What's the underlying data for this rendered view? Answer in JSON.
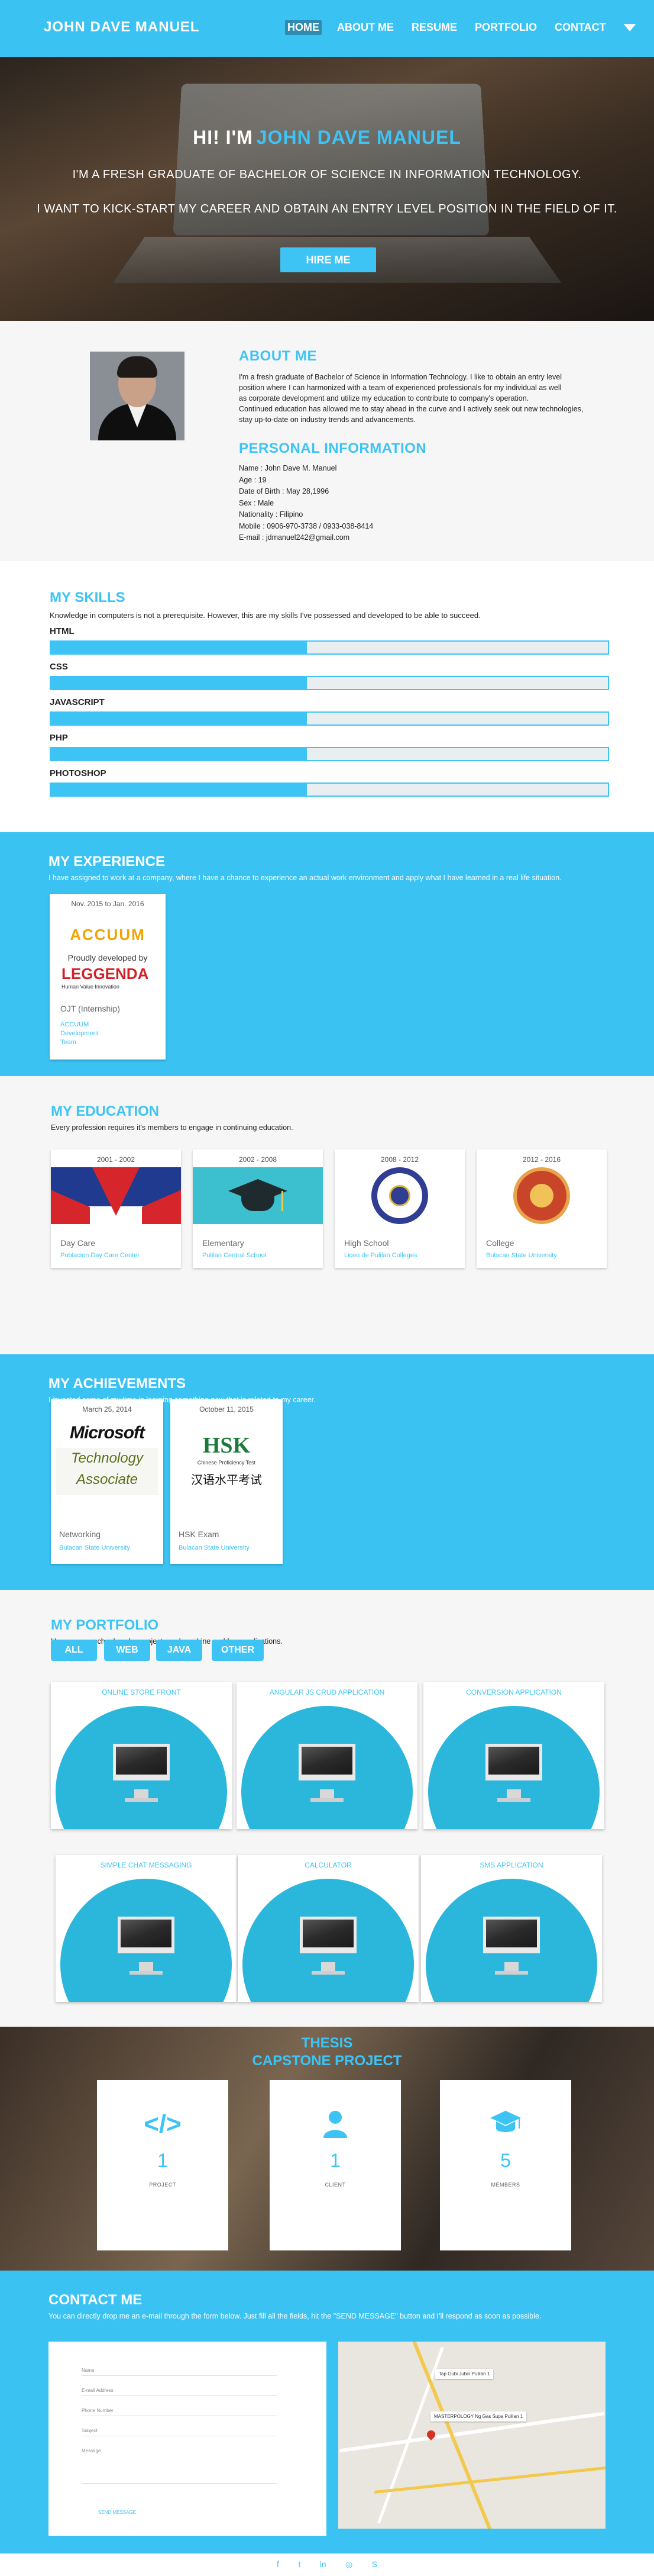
{
  "nav": {
    "brand": "JOHN DAVE MANUEL",
    "links": [
      "HOME",
      "ABOUT ME",
      "RESUME",
      "PORTFOLIO",
      "CONTACT"
    ],
    "active_index": 0
  },
  "hero": {
    "greeting": "HI! I'M",
    "name": "JOHN DAVE MANUEL",
    "line1": "I'M A FRESH GRADUATE OF BACHELOR OF SCIENCE IN INFORMATION TECHNOLOGY.",
    "line2": "I WANT TO KICK-START MY CAREER AND OBTAIN AN ENTRY LEVEL POSITION IN THE FIELD OF IT.",
    "button": "HIRE ME"
  },
  "about": {
    "title": "ABOUT ME",
    "paragraph_lines": [
      "I'm a fresh graduate of Bachelor of Science in Information Technology. I like to obtain an entry level",
      " position where I can harmonized with a team of experienced professionals for my individual as well",
      "as corporate development and utilize my education to contribute to company's operation.",
      "Continued education has allowed me to stay ahead in the curve and I actively seek out new technologies,",
      "stay up-to-date on industry trends and advancements."
    ],
    "info_title": "PERSONAL INFORMATION",
    "info": [
      "Name : John Dave M. Manuel",
      "Age : 19",
      "Date of Birth : May 28,1996",
      "Sex : Male",
      "Nationality : Filipino",
      "Mobile : 0906-970-3738 / 0933-038-8414",
      "E-mail : jdmanuel242@gmail.com"
    ]
  },
  "skills": {
    "title": "MY SKILLS",
    "description": "Knowledge in computers is not a prerequisite. However, this are my skills I've possessed and developed to be able to succeed.",
    "items": [
      {
        "name": "HTML",
        "level": 0.46
      },
      {
        "name": "CSS",
        "level": 0.46
      },
      {
        "name": "JAVASCRIPT",
        "level": 0.46
      },
      {
        "name": "PHP",
        "level": 0.46
      },
      {
        "name": "PHOTOSHOP",
        "level": 0.46
      }
    ]
  },
  "experience": {
    "title": "MY EXPERIENCE",
    "description": "I have assigned to work at a company, where I have a chance to experience an actual work environment and apply what I have learned in a real life situation.",
    "card": {
      "date": "Nov. 2015 to Jan. 2016",
      "logo1": "ACCUUM",
      "logo_caption": "Proudly developed by",
      "logo2": "LEGGENDA",
      "logo2_sub": "Human Value Innovation",
      "title": "OJT (Internship)",
      "sub": [
        "ACCUUM",
        "Development",
        "Team"
      ]
    }
  },
  "education": {
    "title": "MY EDUCATION",
    "description": "Every profession requires it's members to engage in continuing education.",
    "items": [
      {
        "years": "2001 - 2002",
        "level": "Day Care",
        "school": "Poblacion Day Care Center"
      },
      {
        "years": "2002 - 2008",
        "level": "Elementary",
        "school": "Pulilan Central School"
      },
      {
        "years": "2008 - 2012",
        "level": "High School",
        "school": "Liceo de Pulilan Colleges"
      },
      {
        "years": "2012 - 2016",
        "level": "College",
        "school": "Bulacan State University"
      }
    ]
  },
  "achievements": {
    "title": "MY ACHIEVEMENTS",
    "description": "I invested some of my time in learning something new that is related to my career.",
    "items": [
      {
        "date": "March 25, 2014",
        "logo_top": "Microsoft",
        "logo_bottom": "Technology Associate",
        "title": "Networking",
        "sub": "Bulacan State University"
      },
      {
        "date": "October 11, 2015",
        "logo_top": "HSK",
        "logo_mid": "Chinese Proficiency Test",
        "logo_bottom": "汉语水平考试",
        "title": "HSK Exam",
        "sub": "Bulacan State University"
      }
    ]
  },
  "portfolio": {
    "title": "MY PORTFOLIO",
    "description": "Here are my school works, projects and machine problem applications.",
    "filters": [
      "ALL",
      "WEB",
      "JAVA",
      "OTHER"
    ],
    "projects": [
      "ONLINE STORE FRONT",
      "ANGULAR JS CRUD APPLICATION",
      "CONVERSION APPLICATION",
      "SIMPLE CHAT MESSAGING",
      "CALCULATOR",
      "SMS APPLICATION"
    ]
  },
  "thesis": {
    "title1": "THESIS",
    "title2": "CAPSTONE PROJECT",
    "stats": [
      {
        "icon": "code-icon",
        "value": "1",
        "label": "PROJECT"
      },
      {
        "icon": "user-icon",
        "value": "1",
        "label": "CLIENT"
      },
      {
        "icon": "graduation-cap-icon",
        "value": "5",
        "label": "MEMBERS"
      }
    ]
  },
  "contact": {
    "title": "CONTACT ME",
    "description": "You can directly drop me an e-mail through the form below. Just fill all the fields, hit the \"SEND MESSAGE\" button and I'll respond as soon as possible.",
    "fields": [
      "Name",
      "E-mail Address",
      "Phone Number",
      "Subject",
      "Message"
    ],
    "send": "SEND MESSAGE",
    "map_labels": [
      "Tap Gubi Jubin Pulilan 1",
      "MASTERPOLOGY Ng Gas Supa Pulilan 1"
    ]
  },
  "footer": {
    "icons": [
      "facebook-icon",
      "twitter-icon",
      "linkedin-icon",
      "instagram-icon",
      "skype-icon"
    ],
    "glyphs": [
      "f",
      "t",
      "in",
      "◎",
      "S"
    ]
  },
  "colors": {
    "accent": "#3dc4f5",
    "nav": "#3ac2f3"
  }
}
